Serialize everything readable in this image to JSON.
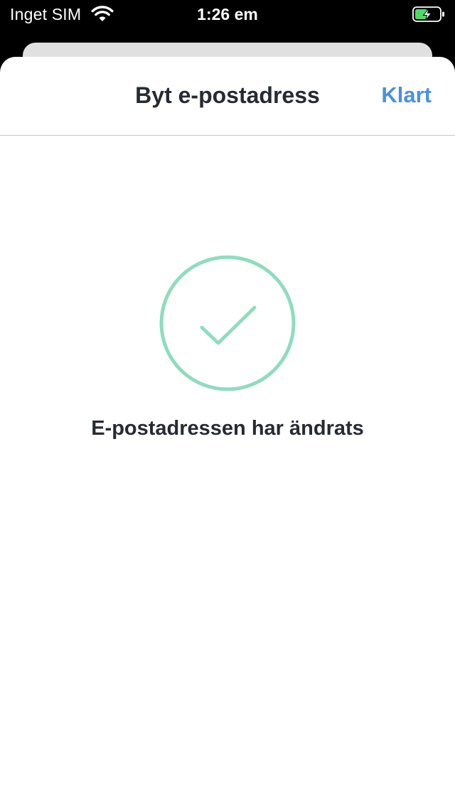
{
  "status_bar": {
    "carrier": "Inget SIM",
    "time": "1:26 em",
    "wifi_icon": "wifi-icon",
    "battery_icon": "battery-charging-icon"
  },
  "nav": {
    "title": "Byt e-postadress",
    "done_label": "Klart"
  },
  "content": {
    "icon": "checkmark-circle-icon",
    "message": "E-postadressen har ändrats"
  },
  "colors": {
    "accent": "#4a90e2",
    "success": "#8fdcbf",
    "text": "#262a33",
    "battery_green": "#4cd964"
  }
}
